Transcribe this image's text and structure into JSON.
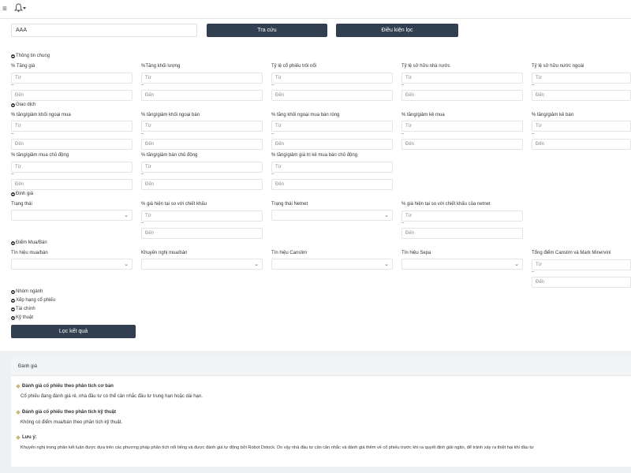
{
  "header": {
    "menu_icon": "hamburger-icon",
    "bell_icon": "bell-icon"
  },
  "search": {
    "value": "AAA"
  },
  "buttons": {
    "lookup": "Tra cứu",
    "filter_conditions": "Điều kiện lọc",
    "filter_results": "Lọc kết quả"
  },
  "sections": {
    "general": "Thông tin chung",
    "trading": "Giao dịch",
    "valuation": "Định giá",
    "buy_sell_points": "Điểm Mua/Bán",
    "industry_group": "Nhóm ngành",
    "stock_ranking": "Xếp hạng cổ phiếu",
    "finance": "Tài chính",
    "technical": "Kỹ thuật"
  },
  "placeholders": {
    "from": "Từ",
    "to": "Đến"
  },
  "dash": "–",
  "general_fields": [
    "% Tăng giá",
    "%Tăng khối lượng",
    "Tỷ lệ cổ phiếu trôi nổi",
    "Tỷ lệ sở hữu nhà nước",
    "Tỷ lệ sở hữu nước ngoài"
  ],
  "trading_fields_row1": [
    "% tăng/giảm khối ngoại mua",
    "% tăng/giảm khối ngoại bán",
    "% tăng khối ngoại mua bán ròng",
    "% tăng/giảm kê mua",
    "% tăng/giảm kê bán"
  ],
  "trading_fields_row2": [
    "% tăng/giảm mua chủ động",
    "% tăng/giảm bán chủ động",
    "% tăng/giảm giá trị kê mua bán chủ động"
  ],
  "valuation_fields": [
    "Trạng thái",
    "% giá hiện tại so với chiết khấu",
    "Trạng thái Netnet",
    "% giá hiện tại so với chiết khấu của netnet"
  ],
  "signal_fields": [
    "Tín hiệu mua/bán",
    "Khuyến nghị mua/bán",
    "Tín hiệu Canslim",
    "Tín hiệu Sepa",
    "Tổng điểm Canslim và Mark Minervini"
  ],
  "evaluation": {
    "title": "Đánh giá",
    "items": [
      {
        "heading": "Đánh giá cổ phiếu theo phân tích cơ bản",
        "text": "Cổ phiếu đang đánh giá rẻ, nhà đầu tư có thể cân nhắc đầu tư trung hạn hoặc dài hạn."
      },
      {
        "heading": "Đánh giá cổ phiếu theo phân tích kỹ thuật",
        "text": "Không có điểm mua/bán theo phân tích kỹ thuật."
      },
      {
        "heading": "Lưu ý:",
        "text": "Khuyến nghị trong phần kết luận được dựa trên các phương pháp phân tích nổi tiếng và được đánh giá tự động bởi Robot Dstock. Do vậy nhà đầu tư cần cân nhắc và đánh giá thêm về cổ phiếu trước khi ra quyết định giải ngân, để tránh xảy ra thiệt hại khi đầu tư"
      }
    ]
  },
  "colors": {
    "dark_button": "#323f50",
    "accent_diamond": "#c7b77a"
  }
}
